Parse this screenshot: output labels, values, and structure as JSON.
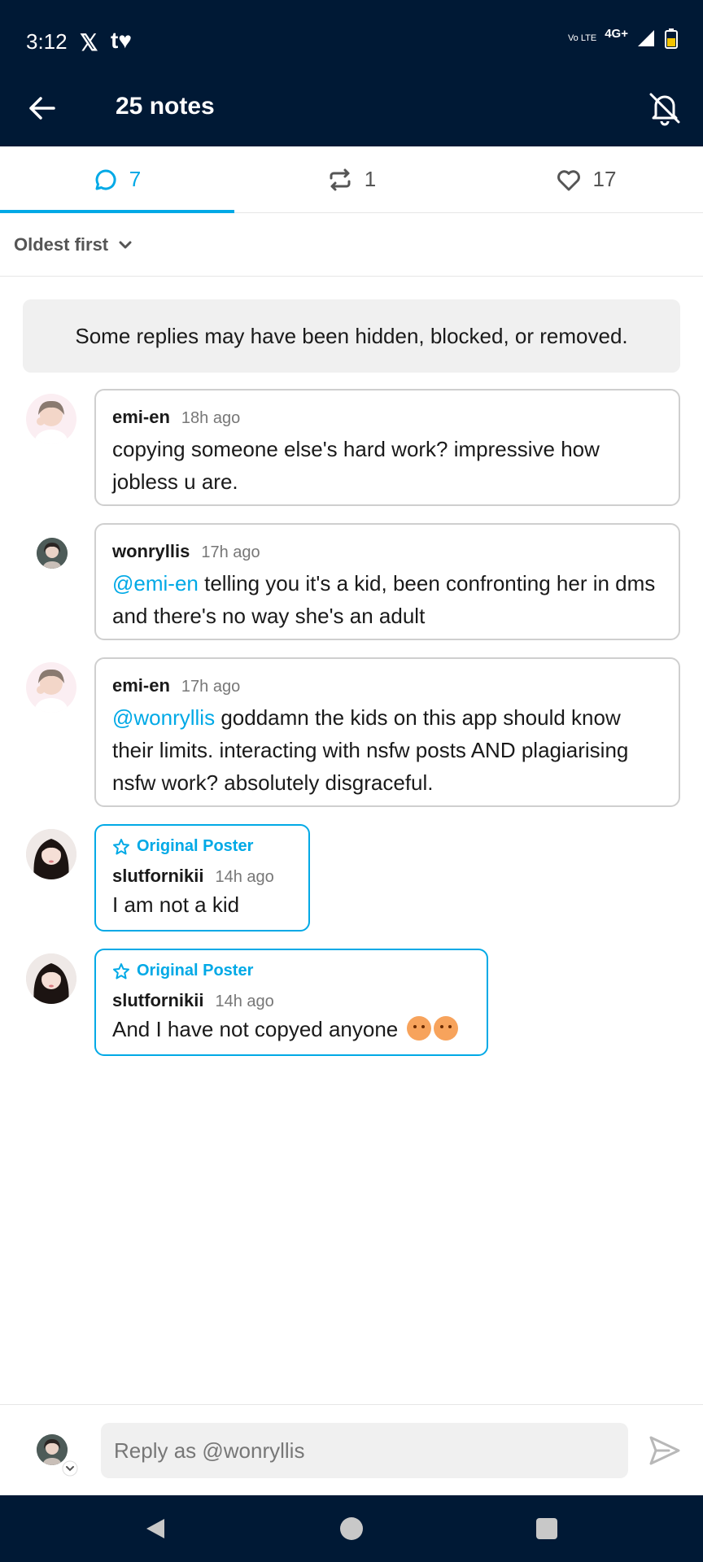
{
  "status_bar": {
    "time": "3:12",
    "app_icons": [
      "x-icon",
      "tumblr-icon"
    ],
    "volte": "Vo LTE",
    "network": "4G+"
  },
  "header": {
    "title": "25 notes"
  },
  "tabs": [
    {
      "icon": "comment-icon",
      "count": "7",
      "active": true
    },
    {
      "icon": "reblog-icon",
      "count": "1",
      "active": false
    },
    {
      "icon": "heart-icon",
      "count": "17",
      "active": false
    }
  ],
  "sort": {
    "label": "Oldest first"
  },
  "notice": "Some replies may have been hidden, blocked, or removed.",
  "replies": [
    {
      "author": "emi-en",
      "time": "18h ago",
      "mention": "",
      "text": "copying someone else's hard work? impressive how jobless u are.",
      "original_poster": false
    },
    {
      "author": "wonryllis",
      "time": "17h ago",
      "mention": "@emi-en",
      "text": "telling you it's a kid, been confronting her in dms and there's no way she's an adult",
      "original_poster": false
    },
    {
      "author": "emi-en",
      "time": "17h ago",
      "mention": "@wonryllis",
      "text": "goddamn the kids on this app should know their limits. interacting with nsfw posts AND plagiarising nsfw work? absolutely disgraceful.",
      "original_poster": false
    },
    {
      "author": "slutfornikii",
      "time": "14h ago",
      "mention": "",
      "text": "I am not a kid",
      "original_poster": true,
      "badge": "Original Poster"
    },
    {
      "author": "slutfornikii",
      "time": "14h ago",
      "mention": "",
      "text": "And I have not copyed anyone",
      "original_poster": true,
      "badge": "Original Poster"
    }
  ],
  "compose": {
    "placeholder": "Reply as @wonryllis"
  },
  "colors": {
    "header_bg": "#001935",
    "accent": "#00a9e6"
  }
}
